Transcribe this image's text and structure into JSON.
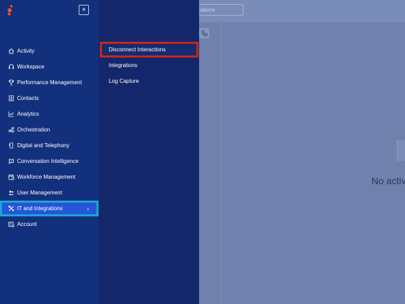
{
  "background": {
    "search_placeholder": "ications",
    "empty_state": "No active",
    "phone_icon": "phone-icon"
  },
  "nav": {
    "close_label": "×",
    "items": [
      {
        "label": "Activity",
        "icon": "home-icon"
      },
      {
        "label": "Workspace",
        "icon": "headset-icon"
      },
      {
        "label": "Performance Management",
        "icon": "trophy-icon"
      },
      {
        "label": "Contacts",
        "icon": "contact-card-icon"
      },
      {
        "label": "Analytics",
        "icon": "line-chart-icon"
      },
      {
        "label": "Orchestration",
        "icon": "flow-icon"
      },
      {
        "label": "Digital and Telephony",
        "icon": "phone-device-icon"
      },
      {
        "label": "Conversation Intelligence",
        "icon": "speech-sparkle-icon"
      },
      {
        "label": "Workforce Management",
        "icon": "calendar-icon"
      },
      {
        "label": "User Management",
        "icon": "users-icon"
      },
      {
        "label": "IT and Integrations",
        "icon": "tools-icon",
        "active": true
      },
      {
        "label": "Account",
        "icon": "account-icon"
      }
    ]
  },
  "submenu": {
    "items": [
      {
        "label": "Disconnect Interactions",
        "selected": true
      },
      {
        "label": "Integrations"
      },
      {
        "label": "Log Capture"
      }
    ]
  },
  "colors": {
    "nav_bg": "#13307d",
    "submenu_bg": "#14276a",
    "active_bg": "#2456d6",
    "active_outline": "#1aa7d9",
    "selected_outline": "#c8261d",
    "logo": "#ff4f1f"
  }
}
